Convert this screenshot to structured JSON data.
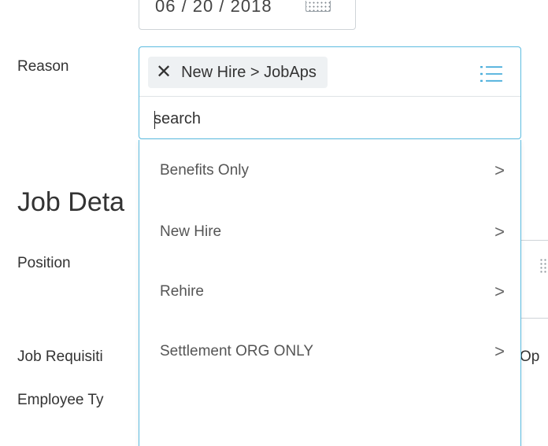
{
  "date_field": {
    "value": "06 / 20 / 2018",
    "icon": "calendar-icon"
  },
  "labels": {
    "reason": "Reason",
    "position": "Position",
    "job_requisition": "Job Requisiti",
    "employee_type": "Employee Ty"
  },
  "section": {
    "title": "Job Deta"
  },
  "reason_selector": {
    "selected_pill": "New Hire > JobAps",
    "remove_icon": "close-icon",
    "list_icon": "list-icon",
    "search_placeholder": "search",
    "accent_color": "#5cbce0"
  },
  "dropdown": {
    "items": [
      {
        "label": "Benefits Only",
        "chevron": ">"
      },
      {
        "label": "New Hire",
        "chevron": ">"
      },
      {
        "label": "Rehire",
        "chevron": ">"
      },
      {
        "label": "Settlement ORG ONLY",
        "chevron": ">"
      }
    ]
  },
  "background": {
    "job_requisition_value": "Op"
  }
}
